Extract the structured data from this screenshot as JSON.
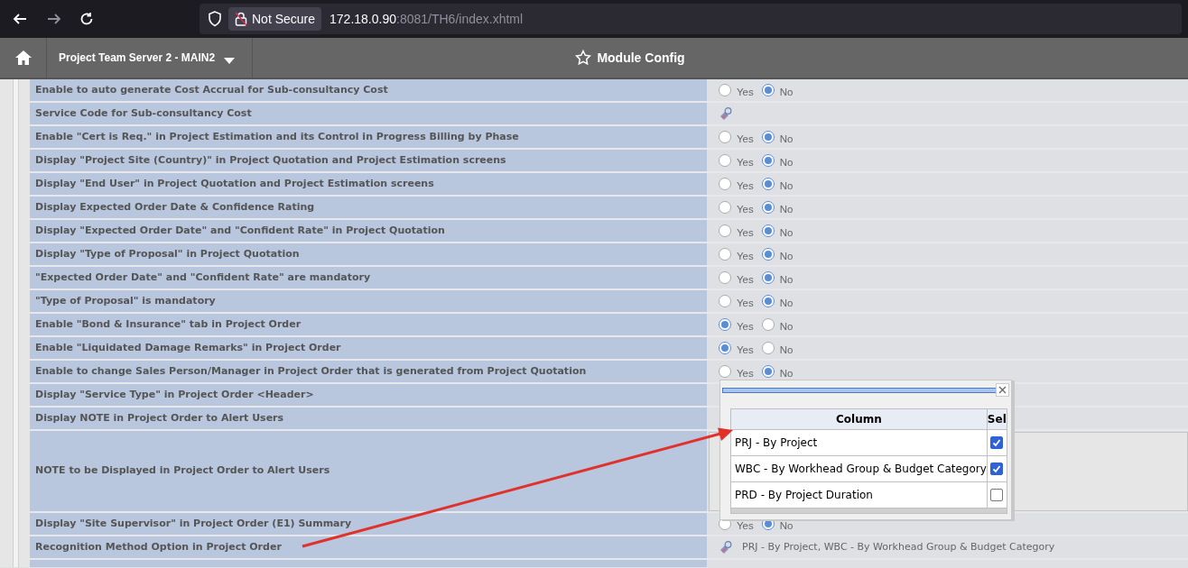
{
  "browser": {
    "security_label": "Not Secure",
    "url_host": "172.18.0.90",
    "url_rest": ":8081/TH6/index.xhtml"
  },
  "header": {
    "project": "Project Team Server 2 - MAIN2",
    "title": "Module Config"
  },
  "rows": [
    {
      "label": "Enable to auto generate Cost Accrual for Sub-consultancy Cost",
      "value": {
        "kind": "radio",
        "options": [
          {
            "label": "Yes",
            "selected": false
          },
          {
            "label": "No",
            "selected": true
          }
        ]
      }
    },
    {
      "label": "Service Code for Sub-consultancy Cost",
      "value": {
        "kind": "lookup"
      }
    },
    {
      "label": "Enable \"Cert is Req.\" in Project Estimation and its Control in Progress Billing by Phase",
      "value": {
        "kind": "radio",
        "options": [
          {
            "label": "Yes",
            "selected": false
          },
          {
            "label": "No",
            "selected": true
          }
        ]
      }
    },
    {
      "label": "Display \"Project Site (Country)\" in Project Quotation and Project Estimation screens",
      "value": {
        "kind": "radio",
        "options": [
          {
            "label": "Yes",
            "selected": false
          },
          {
            "label": "No",
            "selected": true
          }
        ]
      }
    },
    {
      "label": "Display \"End User\" in Project Quotation and Project Estimation screens",
      "value": {
        "kind": "radio",
        "options": [
          {
            "label": "Yes",
            "selected": false
          },
          {
            "label": "No",
            "selected": true
          }
        ]
      }
    },
    {
      "label": "Display Expected Order Date & Confidence Rating",
      "value": {
        "kind": "radio",
        "options": [
          {
            "label": "Yes",
            "selected": false
          },
          {
            "label": "No",
            "selected": true
          }
        ]
      }
    },
    {
      "label": "Display \"Expected Order Date\" and \"Confident Rate\" in Project Quotation",
      "value": {
        "kind": "radio",
        "options": [
          {
            "label": "Yes",
            "selected": false
          },
          {
            "label": "No",
            "selected": true
          }
        ]
      }
    },
    {
      "label": "Display \"Type of Proposal\" in Project Quotation",
      "value": {
        "kind": "radio",
        "options": [
          {
            "label": "Yes",
            "selected": false
          },
          {
            "label": "No",
            "selected": true
          }
        ]
      }
    },
    {
      "label": "\"Expected Order Date\" and \"Confident Rate\" are mandatory",
      "value": {
        "kind": "radio",
        "options": [
          {
            "label": "Yes",
            "selected": false
          },
          {
            "label": "No",
            "selected": true
          }
        ]
      }
    },
    {
      "label": "\"Type of Proposal\" is mandatory",
      "value": {
        "kind": "radio",
        "options": [
          {
            "label": "Yes",
            "selected": false
          },
          {
            "label": "No",
            "selected": true
          }
        ]
      }
    },
    {
      "label": "Enable \"Bond & Insurance\" tab in Project Order",
      "value": {
        "kind": "radio",
        "options": [
          {
            "label": "Yes",
            "selected": true
          },
          {
            "label": "No",
            "selected": false
          }
        ]
      }
    },
    {
      "label": "Enable \"Liquidated Damage Remarks\" in Project Order",
      "value": {
        "kind": "radio",
        "options": [
          {
            "label": "Yes",
            "selected": true
          },
          {
            "label": "No",
            "selected": false
          }
        ]
      }
    },
    {
      "label": "Enable to change Sales Person/Manager in Project Order that is generated from Project Quotation",
      "value": {
        "kind": "radio",
        "options": [
          {
            "label": "Yes",
            "selected": false
          },
          {
            "label": "No",
            "selected": true
          }
        ]
      }
    },
    {
      "label": "Display \"Service Type\" in Project Order <Header>"
    },
    {
      "label": "Display NOTE in Project Order to Alert Users"
    },
    {
      "label": "NOTE to be Displayed in Project Order to Alert Users",
      "value": {
        "kind": "note"
      }
    },
    {
      "label": "Display \"Site Supervisor\" in Project Order (E1) Summary",
      "value": {
        "kind": "radio",
        "options": [
          {
            "label": "Yes",
            "selected": false
          },
          {
            "label": "No",
            "selected": true
          }
        ]
      }
    },
    {
      "label": "Recognition Method Option in Project Order",
      "value": {
        "kind": "lookup",
        "text": "PRJ - By Project, WBC - By Workhead Group & Budget Category"
      }
    }
  ],
  "popup": {
    "columns": [
      "Column",
      "Sel"
    ],
    "rows": [
      {
        "label": "PRJ - By Project",
        "checked": true
      },
      {
        "label": "WBC - By Workhead Group & Budget Category",
        "checked": true
      },
      {
        "label": "PRD - By Project Duration",
        "checked": false
      }
    ]
  }
}
